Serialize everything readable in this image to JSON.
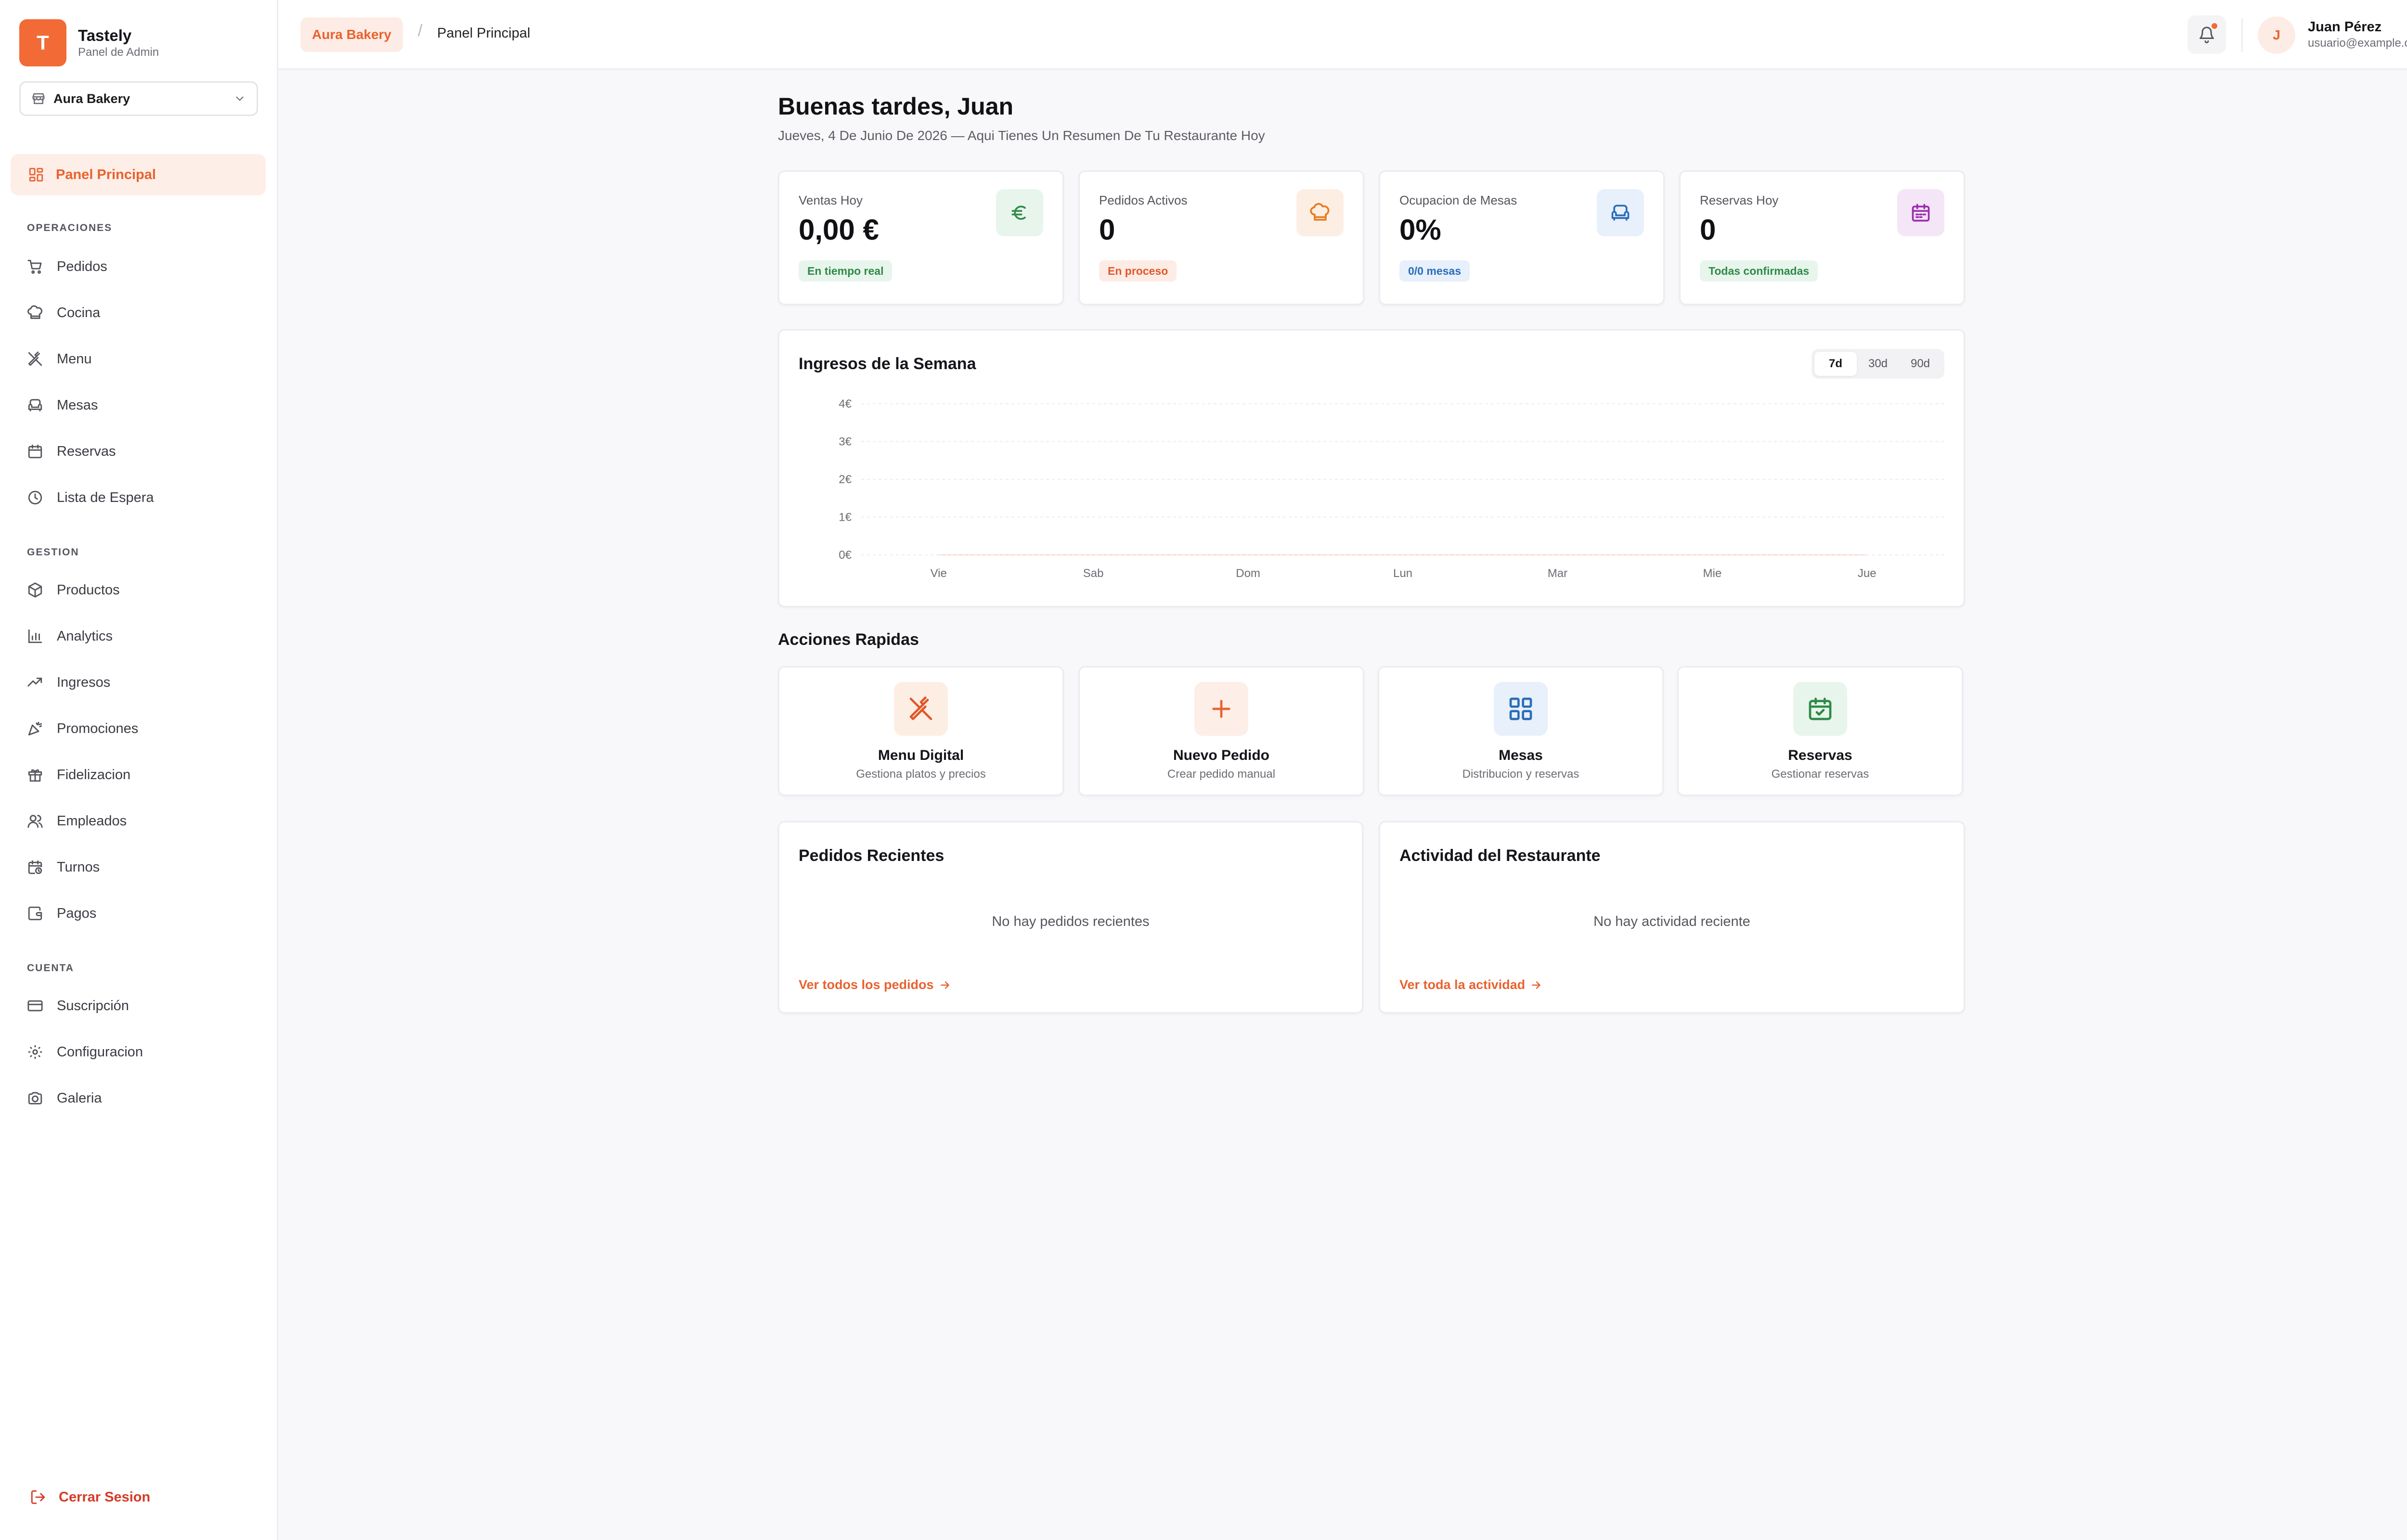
{
  "brand": {
    "initial": "T",
    "name": "Tastely",
    "subtitle": "Panel de Admin"
  },
  "restaurant_selector": {
    "value": "Aura Bakery"
  },
  "nav": {
    "active": {
      "label": "Panel Principal",
      "icon": "dashboard-grid-icon"
    },
    "sections": [
      {
        "title": "OPERACIONES",
        "items": [
          {
            "label": "Pedidos",
            "icon": "shopping-cart-icon"
          },
          {
            "label": "Cocina",
            "icon": "chef-hat-icon"
          },
          {
            "label": "Menu",
            "icon": "utensils-crossed-icon"
          },
          {
            "label": "Mesas",
            "icon": "armchair-icon"
          },
          {
            "label": "Reservas",
            "icon": "calendar-icon"
          },
          {
            "label": "Lista de Espera",
            "icon": "clock-icon"
          }
        ]
      },
      {
        "title": "GESTION",
        "items": [
          {
            "label": "Productos",
            "icon": "package-icon"
          },
          {
            "label": "Analytics",
            "icon": "bar-chart-icon"
          },
          {
            "label": "Ingresos",
            "icon": "trending-up-icon"
          },
          {
            "label": "Promociones",
            "icon": "party-popper-icon"
          },
          {
            "label": "Fidelizacion",
            "icon": "gift-icon"
          },
          {
            "label": "Empleados",
            "icon": "users-icon"
          },
          {
            "label": "Turnos",
            "icon": "calendar-clock-icon"
          },
          {
            "label": "Pagos",
            "icon": "wallet-icon"
          }
        ]
      },
      {
        "title": "CUENTA",
        "items": [
          {
            "label": "Suscripción",
            "icon": "credit-card-icon"
          },
          {
            "label": "Configuracion",
            "icon": "settings-gear-icon"
          },
          {
            "label": "Galeria",
            "icon": "camera-icon"
          }
        ]
      }
    ],
    "logout": "Cerrar Sesion"
  },
  "header": {
    "breadcrumb_restaurant": "Aura Bakery",
    "breadcrumb_separator": "/",
    "breadcrumb_current": "Panel Principal",
    "user": {
      "initial": "J",
      "name": "Juan Pérez",
      "email": "usuario@example.com"
    }
  },
  "greeting": {
    "title": "Buenas tardes, Juan",
    "subtitle": "Jueves, 4 De Junio De 2026 — Aqui Tienes Un Resumen De Tu Restaurante Hoy"
  },
  "stats": [
    {
      "title": "Ventas Hoy",
      "value": "0,00 €",
      "badge": "En tiempo real",
      "icon": "euro-icon",
      "accent": "#2e8a47",
      "tint": "#e8f5ec"
    },
    {
      "title": "Pedidos Activos",
      "value": "0",
      "badge": "En proceso",
      "icon": "chef-hat-icon",
      "accent": "#ea7a1c",
      "tint": "#fdeee4"
    },
    {
      "title": "Ocupacion de Mesas",
      "value": "0%",
      "badge": "0/0 mesas",
      "icon": "armchair-icon",
      "accent": "#2b6cb8",
      "tint": "#e7f0fb"
    },
    {
      "title": "Reservas Hoy",
      "value": "0",
      "badge": "Todas confirmadas",
      "icon": "calendar-icon",
      "accent": "#9c2bb0",
      "tint": "#f4e6f7"
    }
  ],
  "stat_badge_styles": [
    {
      "bg": "#e8f5ec",
      "fg": "#2e8a47"
    },
    {
      "bg": "#fdece5",
      "fg": "#e0572a"
    },
    {
      "bg": "#e7f0fb",
      "fg": "#2b6cb8"
    },
    {
      "bg": "#e8f5ec",
      "fg": "#2e8a47"
    }
  ],
  "revenue": {
    "title": "Ingresos de la Semana",
    "ranges": [
      "7d",
      "30d",
      "90d"
    ],
    "selected_range": "7d"
  },
  "chart_data": {
    "type": "area",
    "title": "Ingresos de la Semana",
    "categories": [
      "Vie",
      "Sab",
      "Dom",
      "Lun",
      "Mar",
      "Mie",
      "Jue"
    ],
    "series": [
      {
        "values": [
          0,
          0,
          0,
          0,
          0,
          0,
          0
        ]
      }
    ],
    "y_ticks": [
      "0€",
      "1€",
      "2€",
      "3€",
      "4€"
    ],
    "ylim": [
      0,
      4
    ],
    "grid": true
  },
  "quick_actions": {
    "title": "Acciones Rapidas",
    "items": [
      {
        "title": "Menu Digital",
        "subtitle": "Gestiona platos y precios",
        "icon": "utensils-crossed-icon",
        "accent": "#e0572a",
        "tint": "#fdeee4"
      },
      {
        "title": "Nuevo Pedido",
        "subtitle": "Crear pedido manual",
        "icon": "plus-icon",
        "accent": "#e8622f",
        "tint": "#fdeee7"
      },
      {
        "title": "Mesas",
        "subtitle": "Distribucion y reservas",
        "icon": "layout-grid-icon",
        "accent": "#2b6cb8",
        "tint": "#e7f0fb"
      },
      {
        "title": "Reservas",
        "subtitle": "Gestionar reservas",
        "icon": "calendar-check-icon",
        "accent": "#2e8a47",
        "tint": "#e8f5ec"
      }
    ]
  },
  "recent_orders": {
    "title": "Pedidos Recientes",
    "empty": "No hay pedidos recientes",
    "link": "Ver todos los pedidos"
  },
  "activity": {
    "title": "Actividad del Restaurante",
    "empty": "No hay actividad reciente",
    "link": "Ver toda la actividad"
  },
  "colors": {
    "brand": "#f26a36",
    "link": "#e8622f",
    "danger": "#d63a24"
  }
}
